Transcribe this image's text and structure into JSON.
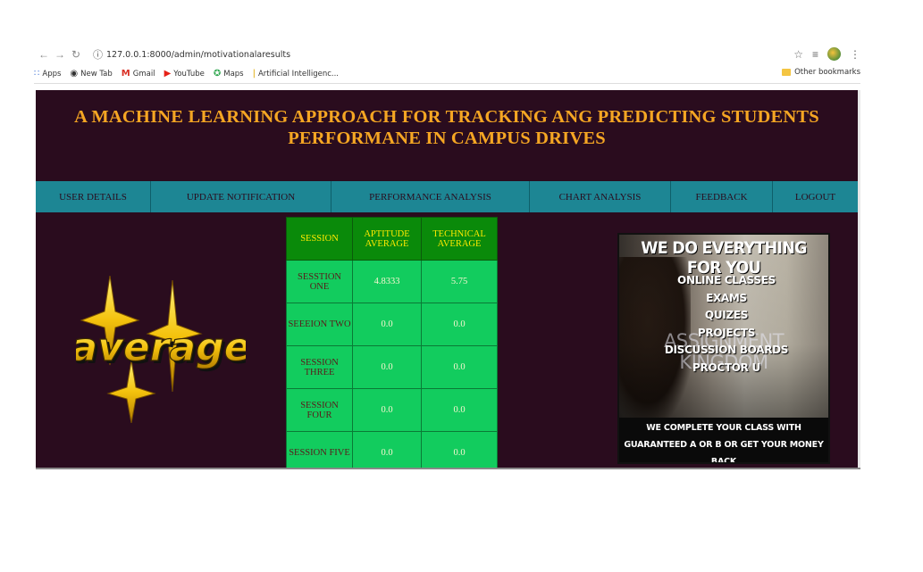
{
  "browser": {
    "url": "127.0.0.1:8000/admin/motivationalaresults",
    "bookmarks": [
      {
        "label": "Apps",
        "icon": "apps-icon"
      },
      {
        "label": "New Tab",
        "icon": "globe-icon"
      },
      {
        "label": "Gmail",
        "icon": "gmail-icon"
      },
      {
        "label": "YouTube",
        "icon": "youtube-icon"
      },
      {
        "label": "Maps",
        "icon": "maps-icon"
      },
      {
        "label": "Artificial Intelligenc...",
        "icon": "bookmark-icon"
      }
    ],
    "other_bookmarks": "Other bookmarks"
  },
  "header": {
    "title_line1": "A MACHINE LEARNING APPROACH FOR TRACKING ANG PREDICTING STUDENTS",
    "title_line2": "PERFORMANE IN CAMPUS DRIVES"
  },
  "nav": [
    "USER DETAILS",
    "UPDATE NOTIFICATION",
    "PERFORMANCE ANALYSIS",
    "CHART ANALYSIS",
    "FEEDBACK",
    "LOGOUT"
  ],
  "average_image": {
    "text": "average"
  },
  "table": {
    "headers": [
      "SESSION",
      "APTITUDE AVERAGE",
      "TECHNICAL AVERAGE"
    ],
    "rows": [
      {
        "session": "SESSTION ONE",
        "aptitude": "4.8333",
        "technical": "5.75"
      },
      {
        "session": "SEEEION TWO",
        "aptitude": "0.0",
        "technical": "0.0"
      },
      {
        "session": "SESSION THREE",
        "aptitude": "0.0",
        "technical": "0.0"
      },
      {
        "session": "SESSION FOUR",
        "aptitude": "0.0",
        "technical": "0.0"
      },
      {
        "session": "SESSION FIVE",
        "aptitude": "0.0",
        "technical": "0.0"
      }
    ]
  },
  "ad": {
    "headline": "WE DO EVERYTHING FOR YOU",
    "items": [
      "ONLINE CLASSES",
      "EXAMS",
      "QUIZES",
      "PROJECTS",
      "DISCUSSION BOARDS",
      "PROCTOR U"
    ],
    "watermark": "ASSIGNMENT KINGDOM",
    "footer_line1": "WE COMPLETE YOUR CLASS WITH",
    "footer_line2": "GUARANTEED A OR B OR GET YOUR MONEY BACK"
  },
  "colors": {
    "page_bg": "#2a0c1e",
    "title": "#f5a623",
    "nav_bg": "#1d8694",
    "table_header": "#0a8a0a",
    "table_cell": "#12cc5e"
  }
}
